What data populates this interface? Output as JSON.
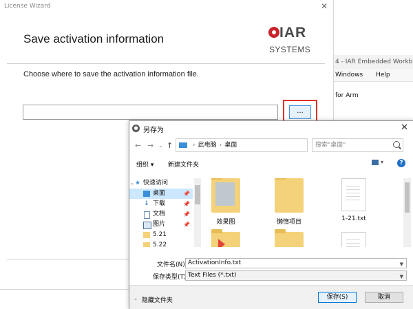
{
  "background_app": {
    "title_fragment": "4 - IAR Embedded Workbenc",
    "menu": [
      "Windows",
      "Help"
    ],
    "subtitle_fragment": "for Arm"
  },
  "wizard": {
    "window_title": "License Wizard",
    "close_glyph": "✕",
    "heading": "Save activation information",
    "logo": {
      "brand": "IAR",
      "sub": "SYSTEMS"
    },
    "prompt": "Choose where to save the activation information file.",
    "path_value": "",
    "browse_label": "...",
    "colors": {
      "highlight": "#e0302a",
      "logo_red": "#c8242b"
    }
  },
  "dialog": {
    "title": "另存为",
    "close_glyph": "✕",
    "nav": {
      "back": "←",
      "forward": "→",
      "up": "↑",
      "dropdown": "⌄"
    },
    "address": {
      "root": "此电脑",
      "current": "桌面"
    },
    "search_placeholder": "搜索\"桌面\"",
    "toolbar": {
      "organize": "组织 ▾",
      "new_folder": "新建文件夹",
      "help": "?"
    },
    "tree": [
      {
        "label": "快速访问",
        "icon": "star-icon",
        "pinned": false,
        "selected": false
      },
      {
        "label": "桌面",
        "icon": "desktop-icon",
        "pinned": true,
        "selected": true
      },
      {
        "label": "下载",
        "icon": "download-icon",
        "pinned": true,
        "selected": false
      },
      {
        "label": "文档",
        "icon": "document-icon",
        "pinned": true,
        "selected": false
      },
      {
        "label": "图片",
        "icon": "picture-icon",
        "pinned": true,
        "selected": false
      },
      {
        "label": "5.21",
        "icon": "folder-icon",
        "pinned": false,
        "selected": false
      },
      {
        "label": "5.22",
        "icon": "folder-icon",
        "pinned": false,
        "selected": false
      }
    ],
    "files": [
      {
        "name": "效果图",
        "kind": "folder"
      },
      {
        "name": "懒惰项目",
        "kind": "folder"
      },
      {
        "name": "1-21.txt",
        "kind": "document"
      },
      {
        "name": "",
        "kind": "folder"
      },
      {
        "name": "",
        "kind": "folder"
      },
      {
        "name": "",
        "kind": "document"
      }
    ],
    "filename_label": "文件名(N):",
    "filename_value": "ActivationInfo.txt",
    "filetype_label": "保存类型(T):",
    "filetype_value": "Text Files (*.txt)",
    "hide_folders": "隐藏文件夹",
    "save_button": "保存(S)",
    "cancel_button": "取消"
  }
}
